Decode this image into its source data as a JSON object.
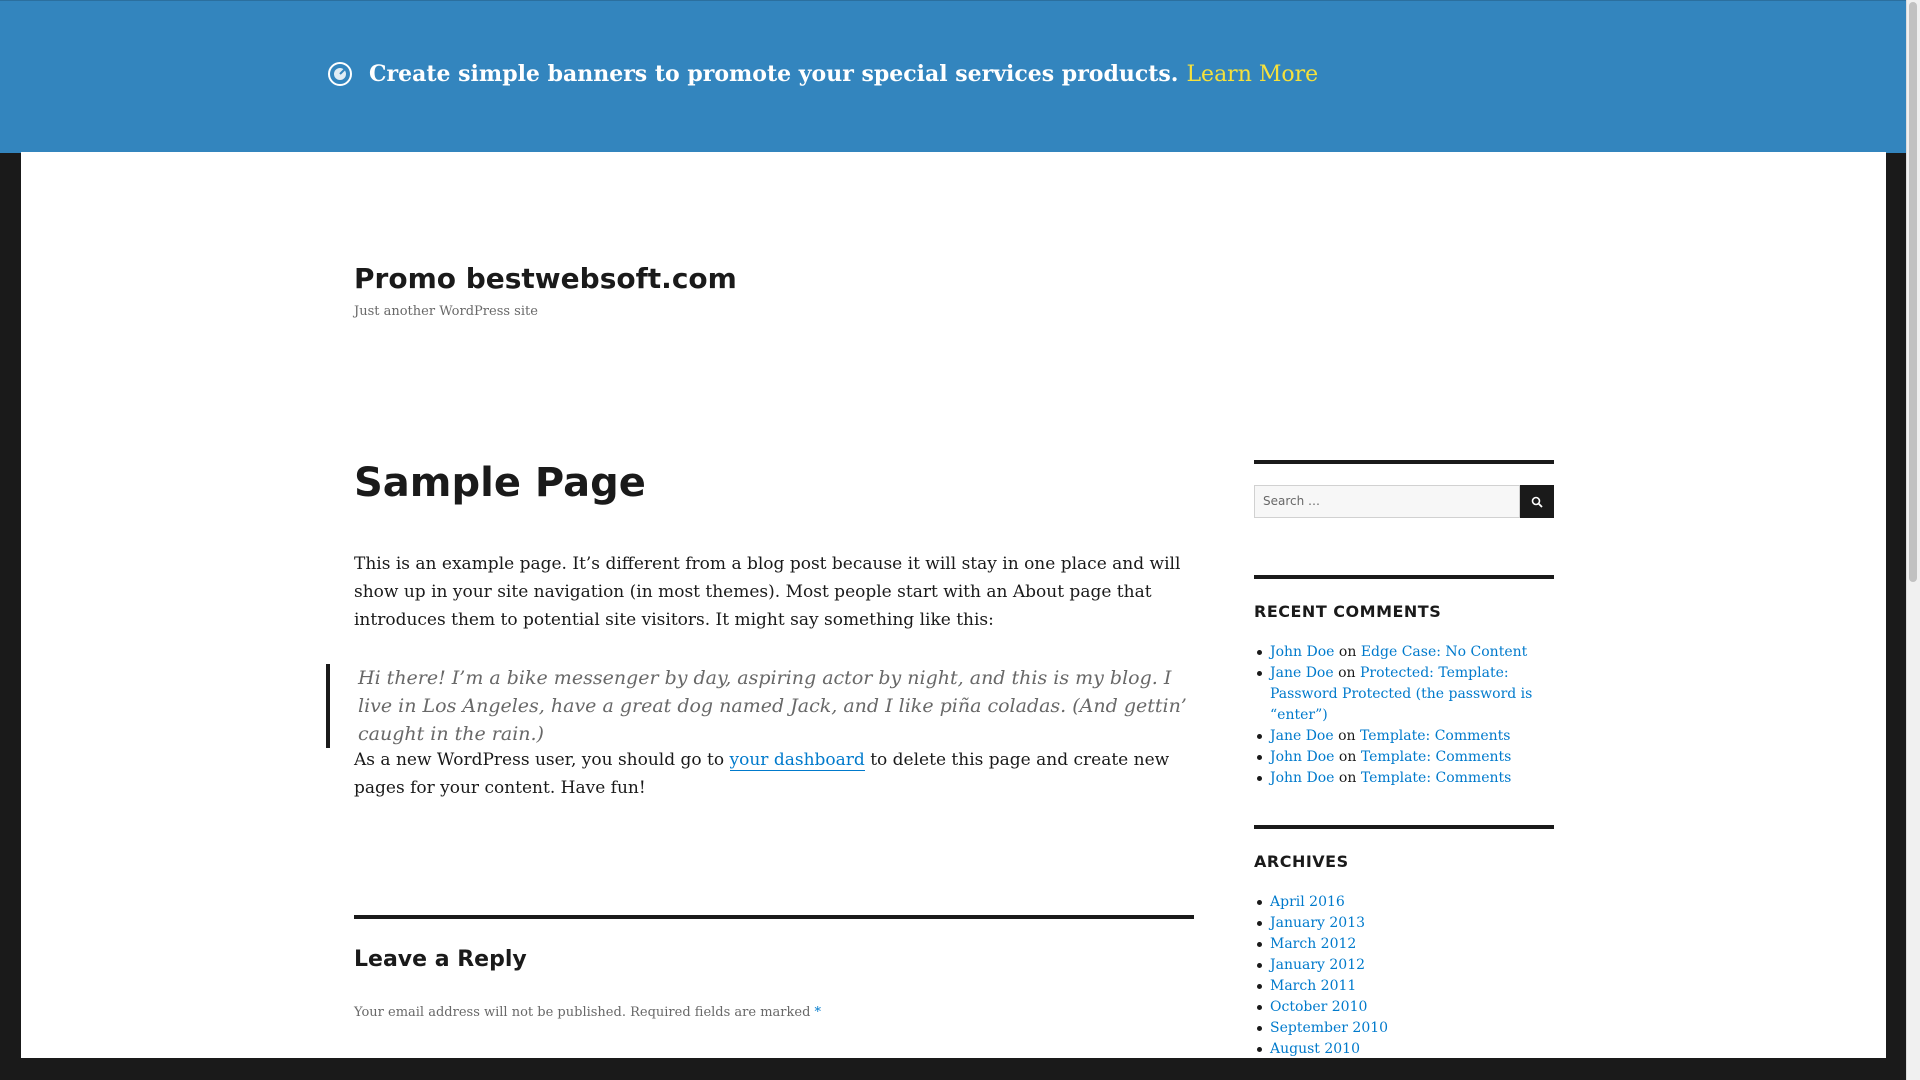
{
  "banner": {
    "text": "Create simple banners to promote your special services products.",
    "link": "Learn More",
    "bg_color": "#3385be",
    "link_color": "#f6e13c",
    "icon": "target-icon"
  },
  "site": {
    "title": "Promo bestwebsoft.com",
    "description": "Just another WordPress site"
  },
  "page": {
    "title": "Sample Page",
    "paragraph1": "This is an example page. It’s different from a blog post because it will stay in one place and will show up in your site navigation (in most themes). Most people start with an About page that introduces them to potential site visitors. It might say something like this:",
    "quote": "Hi there! I’m a bike messenger by day, aspiring actor by night, and this is my blog. I live in Los Angeles, have a great dog named Jack, and I like piña coladas. (And gettin’ caught in the rain.)",
    "paragraph2_before": "As a new WordPress user, you should go to ",
    "paragraph2_link": "your dashboard",
    "paragraph2_after": " to delete this page and create new pages for your content. Have fun!"
  },
  "reply": {
    "title": "Leave a Reply",
    "note": "Your email address will not be published. Required fields are marked",
    "required_mark": "*"
  },
  "sidebar": {
    "search_placeholder": "Search …",
    "recent_comments_title": "RECENT COMMENTS",
    "recent_comments": [
      {
        "author": "John Doe",
        "on": "on",
        "post": "Edge Case: No Content"
      },
      {
        "author": "Jane Doe",
        "on": "on",
        "post": "Protected: Template: Password Protected (the password is “enter”)"
      },
      {
        "author": "Jane Doe",
        "on": "on",
        "post": "Template: Comments"
      },
      {
        "author": "John Doe",
        "on": "on",
        "post": "Template: Comments"
      },
      {
        "author": "John Doe",
        "on": "on",
        "post": "Template: Comments"
      }
    ],
    "archives_title": "ARCHIVES",
    "archives": [
      "April 2016",
      "January 2013",
      "March 2012",
      "January 2012",
      "March 2011",
      "October 2010",
      "September 2010",
      "August 2010"
    ]
  },
  "colors": {
    "link": "#007acc",
    "text": "#1a1a1a",
    "muted": "#686868"
  }
}
